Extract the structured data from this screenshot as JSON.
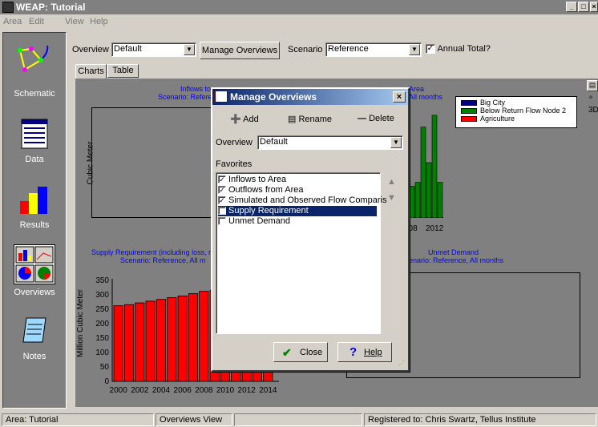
{
  "window": {
    "title": "WEAP: Tutorial"
  },
  "menu": [
    "Area",
    "Edit",
    "View",
    "Help"
  ],
  "sidebar": [
    {
      "label": "Schematic",
      "icon": "schematic-icon"
    },
    {
      "label": "Data",
      "icon": "data-icon"
    },
    {
      "label": "Results",
      "icon": "results-icon"
    },
    {
      "label": "Overviews",
      "icon": "overviews-icon"
    },
    {
      "label": "Notes",
      "icon": "notes-icon"
    }
  ],
  "toolbar": {
    "overview_label": "Overview",
    "overview_value": "Default",
    "manage_button": "Manage Overviews",
    "scenario_label": "Scenario",
    "scenario_value": "Reference",
    "annual_total_label": "Annual Total?",
    "annual_total_checked": true
  },
  "tabs": [
    {
      "label": "Charts",
      "active": true
    },
    {
      "label": "Table",
      "active": false
    }
  ],
  "right_panel": {
    "label": "3D"
  },
  "charts": {
    "top_left": {
      "title1": "Inflows to",
      "title2": "Scenario: Referenc",
      "ylabel": "Cubic Meter"
    },
    "top_right": {
      "title1": "Area",
      "title2": "All months",
      "ticks": [
        "008",
        "2012"
      ]
    },
    "legend": [
      "Big City",
      "Below Return Flow Node 2",
      "Agriculture"
    ],
    "bottom_left": {
      "title1": "Supply Requirement (including loss, r",
      "title2": "Scenario: Reference, All m",
      "ylabel": "Million Cubic Meter"
    },
    "bottom_right": {
      "title1": "Unmet Demand",
      "title2": "enario: Reference, All months"
    }
  },
  "chart_data": [
    {
      "type": "bar",
      "title": "Supply Requirement (including loss, r",
      "ylabel": "Million Cubic Meter",
      "ylim": [
        0,
        350
      ],
      "yticks": [
        "0",
        "50",
        "100",
        "150",
        "200",
        "250",
        "300",
        "350"
      ],
      "xticks": [
        "2000",
        "2002",
        "2004",
        "2006",
        "2008",
        "2010",
        "2012",
        "2014"
      ],
      "categories": [
        "2000",
        "2001",
        "2002",
        "2003",
        "2004",
        "2005",
        "2006",
        "2007",
        "2008",
        "2009",
        "2010",
        "2011",
        "2012",
        "2013",
        "2014"
      ],
      "values": [
        262,
        266,
        272,
        278,
        284,
        290,
        296,
        304,
        312,
        316,
        320,
        324,
        328,
        332,
        336
      ],
      "color": "#ff0000"
    },
    {
      "type": "bar",
      "title": "Area",
      "values": [
        40,
        45,
        115,
        70,
        130,
        45
      ],
      "color": "#008000"
    }
  ],
  "dialog": {
    "title": "Manage Overviews",
    "add": "Add",
    "rename": "Rename",
    "delete": "Delete",
    "overview_label": "Overview",
    "overview_value": "Default",
    "favorites_label": "Favorites",
    "items": [
      {
        "label": "Inflows to Area",
        "checked": true,
        "selected": false
      },
      {
        "label": "Outflows from Area",
        "checked": true,
        "selected": false
      },
      {
        "label": "Simulated and Observed Flow Comparis",
        "checked": true,
        "selected": false
      },
      {
        "label": "Supply Requirement",
        "checked": false,
        "selected": true
      },
      {
        "label": "Unmet Demand",
        "checked": false,
        "selected": false
      }
    ],
    "close": "Close",
    "help": "Help"
  },
  "status": {
    "area": "Area: Tutorial",
    "view": "Overviews View",
    "registered": "Registered to: Chris Swartz, Tellus Institute"
  }
}
